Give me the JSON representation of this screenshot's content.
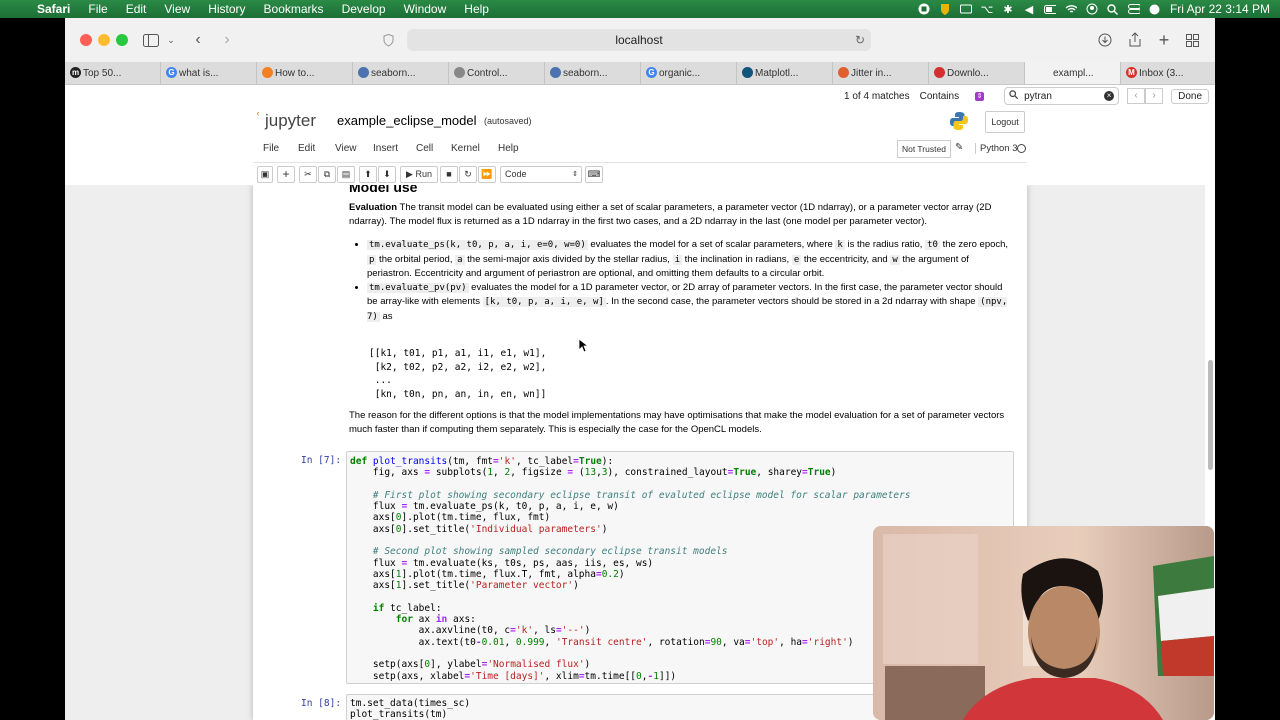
{
  "menubar": {
    "app": "Safari",
    "items": [
      "File",
      "Edit",
      "View",
      "History",
      "Bookmarks",
      "Develop",
      "Window",
      "Help"
    ],
    "datetime": "Fri Apr 22  3:14 PM"
  },
  "browser": {
    "url": "localhost",
    "tabs": [
      {
        "label": "Top 50...",
        "icon": "m-icon",
        "color": "#222"
      },
      {
        "label": "what is...",
        "icon": "google-icon",
        "color": "#4285f4"
      },
      {
        "label": "How to...",
        "icon": "orange-icon",
        "color": "#f48024"
      },
      {
        "label": "seaborn...",
        "icon": "seaborn-icon",
        "color": "#4c72b0"
      },
      {
        "label": "Control...",
        "icon": "gear-icon",
        "color": "#888"
      },
      {
        "label": "seaborn...",
        "icon": "seaborn-icon",
        "color": "#4c72b0"
      },
      {
        "label": "organic...",
        "icon": "google-icon",
        "color": "#4285f4"
      },
      {
        "label": "Matplotl...",
        "icon": "matplotlib-icon",
        "color": "#11557c"
      },
      {
        "label": "Jitter in...",
        "icon": "jitter-icon",
        "color": "#e06030"
      },
      {
        "label": "Downlo...",
        "icon": "download-icon",
        "color": "#d32f2f"
      },
      {
        "label": "exampl...",
        "icon": "jupyter-icon",
        "color": "#f37726"
      },
      {
        "label": "Inbox (3...",
        "icon": "gmail-icon",
        "color": "#d93025"
      }
    ],
    "find": {
      "matches": "1 of 4 matches",
      "mode": "Contains",
      "query": "pytran",
      "done": "Done"
    }
  },
  "jupyter": {
    "logo_text": "jupyter",
    "notebook_title": "example_eclipse_model",
    "autosaved": "(autosaved)",
    "logout": "Logout",
    "menu": [
      "File",
      "Edit",
      "View",
      "Insert",
      "Cell",
      "Kernel",
      "Help"
    ],
    "not_trusted": "Not Trusted",
    "kernel": "Python 3",
    "toolbar": {
      "run": "Run",
      "cell_type": "Code"
    }
  },
  "notebook": {
    "heading_partial": "Model use",
    "eval_bold": "Evaluation",
    "eval_text": " The transit model can be evaluated using either a set of scalar parameters, a parameter vector (1D ndarray), or a parameter vector array (2D ndarray). The model flux is returned as a 1D ndarray in the first two cases, and a 2D ndarray in the last (one model per parameter vector).",
    "bullet1": {
      "code": "tm.evaluate_ps(k, t0, p, a, i, e=0, w=0)",
      "t1": " evaluates the model for a set of scalar parameters, where ",
      "c_k": "k",
      "t2": " is the radius ratio, ",
      "c_t0": "t0",
      "t3": " the zero epoch, ",
      "c_p": "p",
      "t4": " the orbital period, ",
      "c_a": "a",
      "t5": " the semi-major axis divided by the stellar radius, ",
      "c_i": "i",
      "t6": " the inclination in radians, ",
      "c_e": "e",
      "t7": " the eccentricity, and ",
      "c_w": "w",
      "t8": " the argument of periastron. Eccentricity and argument of periastron are optional, and omitting them defaults to a circular orbit."
    },
    "bullet2": {
      "code": "tm.evaluate_pv(pv)",
      "t1": " evaluates the model for a 1D parameter vector, or 2D array of parameter vectors. In the first case, the parameter vector should be array-like with elements ",
      "c_elems": "[k, t0, p, a, i, e, w]",
      "t2": ". In the second case, the parameter vectors should be stored in a 2d ndarray with shape ",
      "c_shape": "(npv, 7)",
      "t3": " as"
    },
    "array_block": "[[k1, t01, p1, a1, i1, e1, w1],\n [k2, t02, p2, a2, i2, e2, w2],\n ...\n [kn, t0n, pn, an, in, en, wn]]",
    "reason_text": "The reason for the different options is that the model implementations may have optimisations that make the model evaluation for a set of parameter vectors much faster than if computing them separately. This is especially the case for the OpenCL models.",
    "cell7_prompt": "In [7]:",
    "cell8_prompt": "In [8]:",
    "cell8_code": "tm.set_data(times_sc)\nplot_transits(tm)"
  }
}
